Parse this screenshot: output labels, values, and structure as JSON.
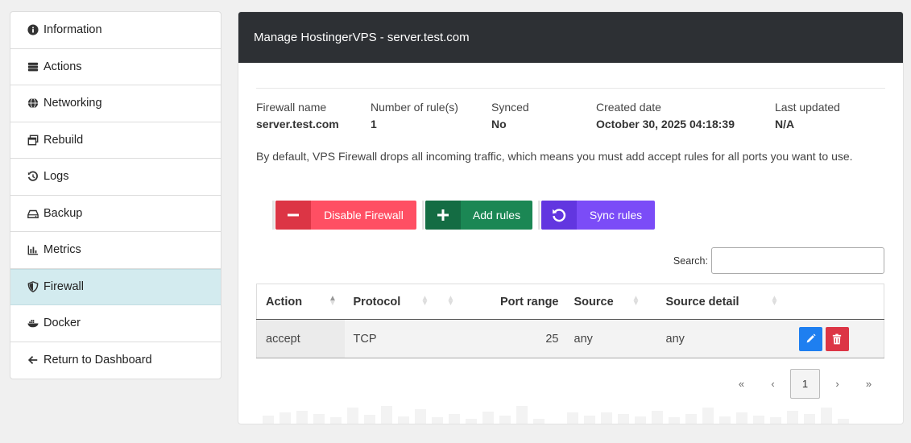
{
  "sidebar": {
    "items": [
      {
        "label": "Information",
        "icon": "info-circle-icon"
      },
      {
        "label": "Actions",
        "icon": "server-icon"
      },
      {
        "label": "Networking",
        "icon": "globe-icon"
      },
      {
        "label": "Rebuild",
        "icon": "window-restore-icon"
      },
      {
        "label": "Logs",
        "icon": "history-icon"
      },
      {
        "label": "Backup",
        "icon": "hdd-icon"
      },
      {
        "label": "Metrics",
        "icon": "chart-bar-icon"
      },
      {
        "label": "Firewall",
        "icon": "shield-icon",
        "active": true
      },
      {
        "label": "Docker",
        "icon": "docker-icon"
      },
      {
        "label": "Return to Dashboard",
        "icon": "arrow-left-icon"
      }
    ]
  },
  "panel": {
    "title": "Manage HostingerVPS - server.test.com"
  },
  "info": {
    "firewall_name_label": "Firewall name",
    "firewall_name": "server.test.com",
    "rules_label": "Number of rule(s)",
    "rules": "1",
    "synced_label": "Synced",
    "synced": "No",
    "created_label": "Created date",
    "created": "October 30, 2025 04:18:39",
    "updated_label": "Last updated",
    "updated": "N/A"
  },
  "description": "By default, VPS Firewall drops all incoming traffic, which means you must add accept rules for all ports you want to use.",
  "buttons": {
    "disable": "Disable Firewall",
    "add": "Add rules",
    "sync": "Sync rules"
  },
  "search": {
    "label": "Search:",
    "value": ""
  },
  "table": {
    "headers": [
      "Action",
      "Protocol",
      "Port range",
      "Source",
      "Source detail",
      ""
    ],
    "rows": [
      {
        "action": "accept",
        "protocol": "TCP",
        "port": "25",
        "source": "any",
        "detail": "any"
      }
    ]
  },
  "pagination": {
    "first": "«",
    "prev": "‹",
    "current": "1",
    "next": "›",
    "last": "»"
  },
  "colors": {
    "header_bg": "#2d3034",
    "active_bg": "#d3ebef",
    "danger": "#dc3545",
    "success": "#146c43",
    "purple": "#6236e0",
    "primary": "#1e7ff0"
  }
}
